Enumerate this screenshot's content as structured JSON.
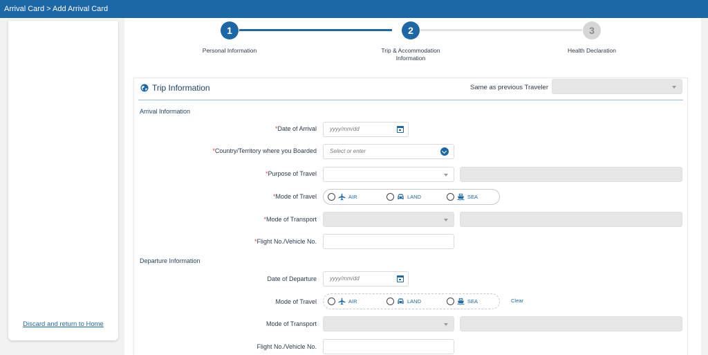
{
  "header": {
    "breadcrumb": "Arrival Card > Add Arrival Card"
  },
  "sidebar": {
    "discard_link": "Discard and return to Home"
  },
  "stepper": {
    "steps": [
      {
        "number": "1",
        "label": "Personal Information",
        "state": "completed"
      },
      {
        "number": "2",
        "label": "Trip & Accommodation Information",
        "label_line1": "Trip & Accommodation",
        "label_line2": "Information",
        "state": "current"
      },
      {
        "number": "3",
        "label": "Health Declaration",
        "state": "upcoming"
      }
    ]
  },
  "trip": {
    "title": "Trip Information",
    "title_icon": "globe-icon",
    "same_as_label": "Same as previous Traveler",
    "same_as_value": "",
    "arrival": {
      "section_title": "Arrival Information",
      "date_label": "Date of Arrival",
      "date_placeholder": "yyyy/mm/dd",
      "country_label": "Country/Territory where you Boarded",
      "country_placeholder": "Select or enter",
      "purpose_label": "Purpose of Travel",
      "mode_label": "Mode of Travel",
      "transport_label": "Mode of Transport",
      "flight_label": "Flight No./Vehicle No.",
      "required_mark": "*"
    },
    "departure": {
      "section_title": "Departure Information",
      "date_label": "Date of Departure",
      "date_placeholder": "yyyy/mm/dd",
      "mode_label": "Mode of Travel",
      "clear_label": "Clear",
      "transport_label": "Mode of Transport",
      "flight_label": "Flight No./Vehicle No."
    },
    "travel_modes": [
      {
        "label": "AIR",
        "icon": "plane-icon"
      },
      {
        "label": "LAND",
        "icon": "car-icon"
      },
      {
        "label": "SEA",
        "icon": "ship-icon"
      }
    ]
  },
  "colors": {
    "brand": "#1e67a6",
    "required": "#e0463b",
    "disabled": "#e6e6e6"
  }
}
